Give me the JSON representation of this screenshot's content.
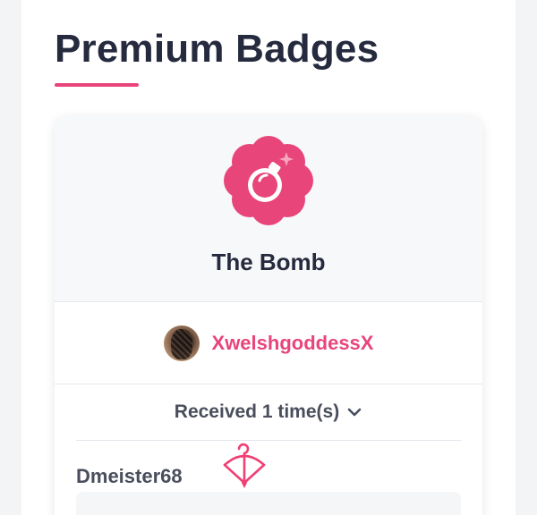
{
  "page": {
    "title": "Premium Badges"
  },
  "badge": {
    "name": "The Bomb",
    "icon": "bomb-icon",
    "accent_color": "#e8457a"
  },
  "owner": {
    "username": "XwelshgoddessX",
    "avatar": "avatar"
  },
  "received": {
    "label": "Received 1 time(s)",
    "toggle_icon": "chevron-down-icon"
  },
  "senders": [
    {
      "username": "Dmeister68",
      "icon": "cupid-bow-icon"
    }
  ]
}
